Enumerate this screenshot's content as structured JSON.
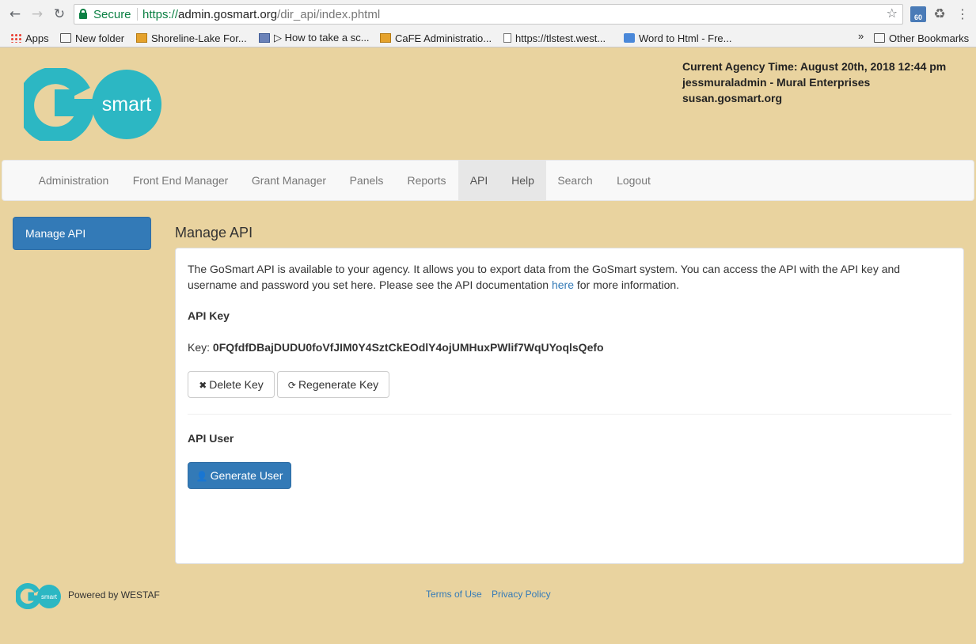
{
  "browser": {
    "secure_label": "Secure",
    "url_scheme": "https://",
    "url_host": "admin.gosmart.org",
    "url_path": "/dir_api/index.phtml",
    "extension_badge": "60",
    "bookmarks": [
      {
        "label": "Apps",
        "icon": "apps-grid-icon"
      },
      {
        "label": "New folder",
        "icon": "folder-icon"
      },
      {
        "label": "Shoreline-Lake For...",
        "icon": "cafe-icon"
      },
      {
        "label": "▷ How to take a sc...",
        "icon": "image-icon"
      },
      {
        "label": "CaFE Administratio...",
        "icon": "cafe-icon"
      },
      {
        "label": "https://tlstest.west...",
        "icon": "page-icon"
      },
      {
        "label": "Word to Html - Fre...",
        "icon": "code-icon"
      }
    ],
    "more_bookmarks": "»",
    "other_bookmarks": "Other Bookmarks"
  },
  "header": {
    "agency_time": "Current Agency Time: August 20th, 2018 12:44 pm",
    "user_line": "jessmuraladmin - Mural Enterprises",
    "site": "susan.gosmart.org",
    "logo_text": "smart"
  },
  "nav": {
    "items": [
      "Administration",
      "Front End Manager",
      "Grant Manager",
      "Panels",
      "Reports",
      "API",
      "Help",
      "Search",
      "Logout"
    ],
    "active": "API"
  },
  "sidebar": {
    "active_item": "Manage API"
  },
  "main": {
    "title": "Manage API",
    "intro_part1": "The GoSmart API is available to your agency. It allows you to export data from the GoSmart system. You can access the API with the API key and username and password you set here. Please see the API documentation ",
    "intro_link": "here",
    "intro_part2": " for more information.",
    "api_key_heading": "API Key",
    "key_label": "Key: ",
    "key_value": "0FQfdfDBajDUDU0foVfJIM0Y4SztCkEOdlY4ojUMHuxPWlif7WqUYoqlsQefo",
    "delete_label": "Delete Key",
    "regenerate_label": "Regenerate Key",
    "api_user_heading": "API User",
    "generate_user_label": "Generate User"
  },
  "footer": {
    "logo_text": "smart",
    "powered_by": "Powered by WESTAF",
    "terms": "Terms of Use",
    "privacy": "Privacy Policy"
  },
  "colors": {
    "page_bg": "#e9d39f",
    "brand_teal": "#2cb7c3",
    "primary": "#337ab7"
  }
}
